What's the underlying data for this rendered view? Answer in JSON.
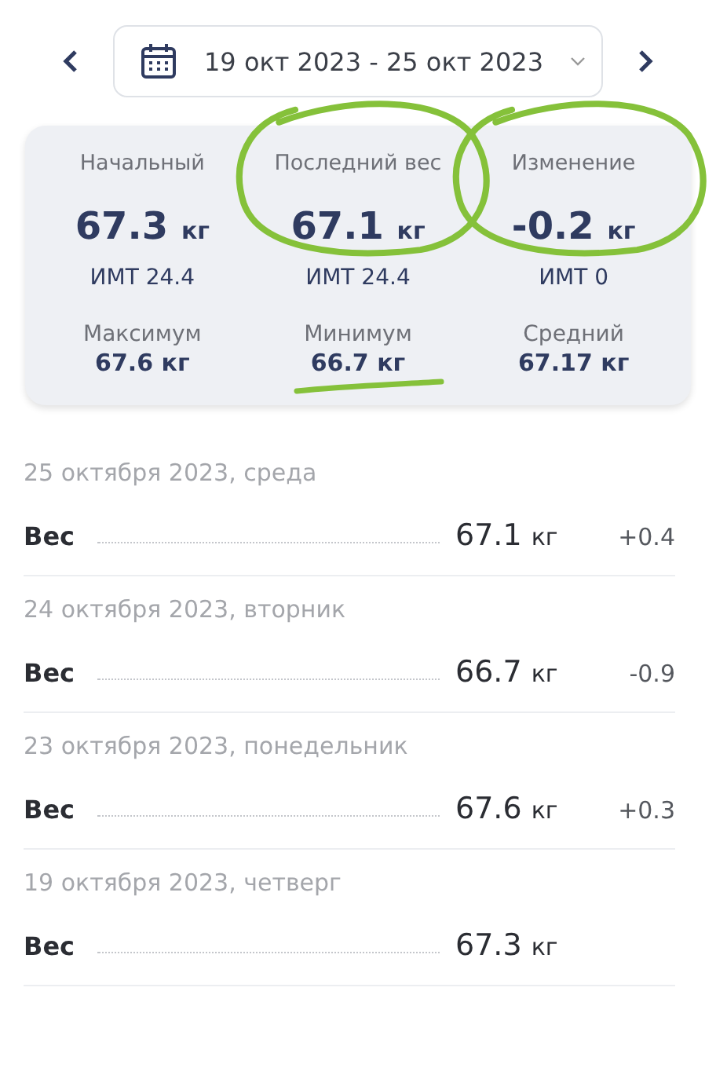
{
  "date_range": {
    "label": "19 окт 2023 - 25 окт 2023"
  },
  "summary": {
    "primary": [
      {
        "label": "Начальный",
        "value": "67.3",
        "unit": "кг",
        "bmi": "ИМТ 24.4",
        "kind": "plain"
      },
      {
        "label": "Последний вес",
        "value": "67.1",
        "unit": "кг",
        "bmi": "ИМТ 24.4",
        "kind": "circled"
      },
      {
        "label": "Изменение",
        "value": "-0.2",
        "unit": "кг",
        "bmi": "ИМТ 0",
        "kind": "circled"
      }
    ],
    "secondary": [
      {
        "label": "Максимум",
        "value": "67.6 кг",
        "kind": "plain"
      },
      {
        "label": "Минимум",
        "value": "66.7 кг",
        "kind": "underlined"
      },
      {
        "label": "Средний",
        "value": "67.17 кг",
        "kind": "plain"
      }
    ]
  },
  "entries": [
    {
      "date": "25 октября 2023, среда",
      "label": "Вес",
      "value": "67.1",
      "unit": "кг",
      "delta": "+0.4"
    },
    {
      "date": "24 октября 2023, вторник",
      "label": "Вес",
      "value": "66.7",
      "unit": "кг",
      "delta": "-0.9"
    },
    {
      "date": "23 октября 2023, понедельник",
      "label": "Вес",
      "value": "67.6",
      "unit": "кг",
      "delta": "+0.3"
    },
    {
      "date": "19 октября 2023, четверг",
      "label": "Вес",
      "value": "67.3",
      "unit": "кг"
    }
  ]
}
